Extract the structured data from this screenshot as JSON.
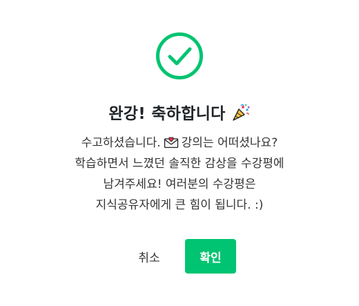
{
  "dialog": {
    "icon": "check-circle-icon",
    "title": "완강! 축하합니다",
    "title_icon": "party-popper-icon",
    "message": {
      "line1_before": "수고하셨습니다.",
      "line1_icon": "love-letter-icon",
      "line1_after": "강의는 어떠셨나요?",
      "line2": "학습하면서 느꼈던 솔직한 감상을 수강평에",
      "line3": "남겨주세요! 여러분의 수강평은",
      "line4": "지식공유자에게 큰 힘이 됩니다. :)"
    },
    "cancel_label": "취소",
    "confirm_label": "확인"
  },
  "colors": {
    "accent": "#00c471",
    "text": "#212529",
    "background": "#ffffff"
  }
}
